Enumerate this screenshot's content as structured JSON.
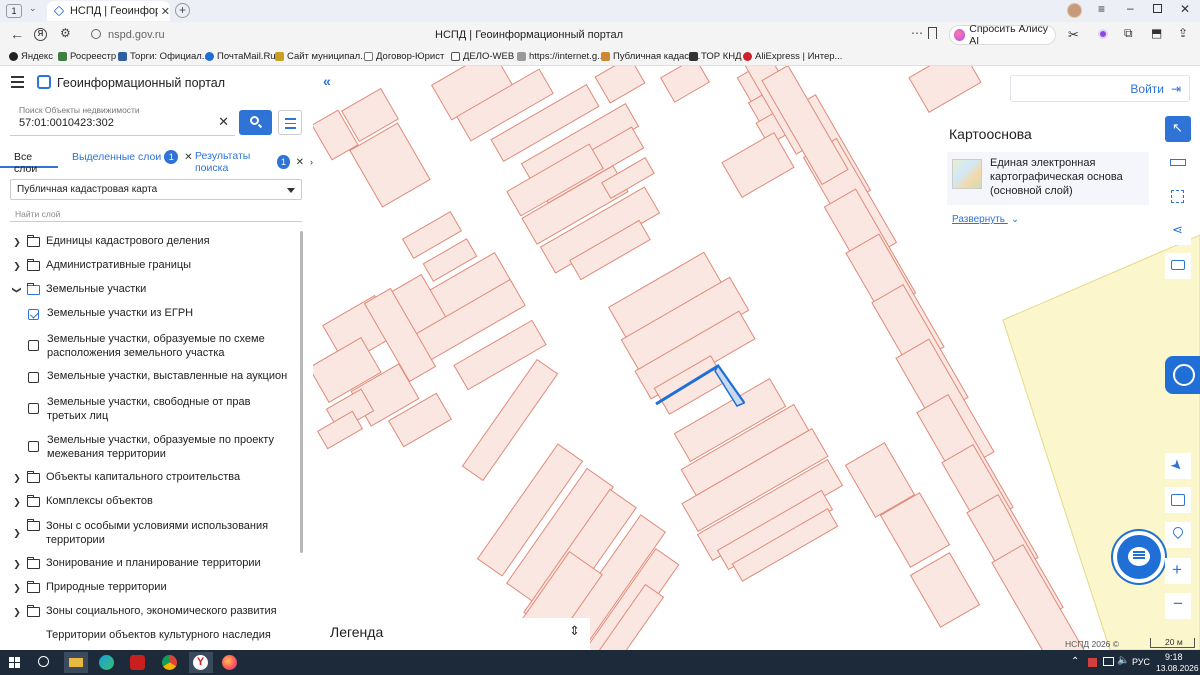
{
  "browser": {
    "tab_counter": "1",
    "tab_title": "НСПД | Геоинформационный портал",
    "tab_close": "✕",
    "new_tab": "+",
    "url": "nspd.gov.ru",
    "window_title": "НСПД | Геоинформационный портал",
    "alice_label": "Спросить Алису AI"
  },
  "bookmarks": [
    {
      "label": "Яндекс",
      "color": "#222222"
    },
    {
      "label": "Росреестр",
      "color": "#3f7f3f"
    },
    {
      "label": "Торги: Официал...",
      "color": "#2f5fa0"
    },
    {
      "label": "ПочтаMail.Ru",
      "color": "#1f6fd6"
    },
    {
      "label": "Сайт муниципал...",
      "color": "#c8a020"
    },
    {
      "label": "Договор-Юрист",
      "color": "#777777"
    },
    {
      "label": "ДЕЛО-WEB",
      "color": "#555555"
    },
    {
      "label": "https://internet.g...",
      "color": "#999999"
    },
    {
      "label": "Публичная кадаст...",
      "color": "#cc8833"
    },
    {
      "label": "ТОР КНД",
      "color": "#333333"
    },
    {
      "label": "AliExpress | Интер...",
      "color": "#d0202a"
    }
  ],
  "app": {
    "title": "Геоинформационный портал",
    "search_placeholder_label": "Поиск Объекты недвижимости",
    "search_value": "57:01:0010423:302",
    "tabs": [
      {
        "label": "Все слои"
      },
      {
        "label": "Выделенные слои",
        "count": "1"
      },
      {
        "label": "Результаты поиска",
        "count": "1"
      }
    ],
    "basemap_select": "Публичная кадастровая карта",
    "find_layer_placeholder": "Найти слой",
    "tree": [
      {
        "label": "Единицы кадастрового деления",
        "type": "folder",
        "expanded": false
      },
      {
        "label": "Административные границы",
        "type": "folder",
        "expanded": false
      },
      {
        "label": "Земельные участки",
        "type": "folder",
        "expanded": true
      },
      {
        "label": "Земельные участки из ЕГРН",
        "type": "check",
        "checked": true
      },
      {
        "label": "Земельные участки, образуемые по схеме расположения земельного участка",
        "type": "check",
        "checked": false
      },
      {
        "label": "Земельные участки, выставленные на аукцион",
        "type": "check",
        "checked": false
      },
      {
        "label": "Земельные участки, свободные от прав третьих лиц",
        "type": "check",
        "checked": false
      },
      {
        "label": "Земельные участки, образуемые по проекту межевания территории",
        "type": "check",
        "checked": false
      },
      {
        "label": "Объекты капитального строительства",
        "type": "folder",
        "expanded": false
      },
      {
        "label": "Комплексы объектов",
        "type": "folder",
        "expanded": false
      },
      {
        "label": "Зоны с особыми условиями использования территории",
        "type": "folder",
        "expanded": false
      },
      {
        "label": "Зонирование и планирование территории",
        "type": "folder",
        "expanded": false
      },
      {
        "label": "Природные территории",
        "type": "folder",
        "expanded": false
      },
      {
        "label": "Зоны социального, экономического развития",
        "type": "folder",
        "expanded": false
      },
      {
        "label": "Территории объектов культурного наследия",
        "type": "folder",
        "expanded": false
      }
    ]
  },
  "map": {
    "login_label": "Войти",
    "basemap_title": "Картооснова",
    "basemap_name": "Единая электронная картографическая основа (основной слой)",
    "expand_label": "Развернуть",
    "legend_label": "Легенда",
    "copyright": "НСПД 2026 ©",
    "scale": "20 м",
    "colors": {
      "parcel_stroke": "#e08a78",
      "parcel_fill": "#fbe7e2",
      "selected": "#1f6fd6",
      "zone_fill": "#fbf6cc",
      "accent": "#1f6fd6"
    }
  },
  "taskbar": {
    "time": "9:18",
    "date": "13.08.2026",
    "lang": "РУС"
  }
}
